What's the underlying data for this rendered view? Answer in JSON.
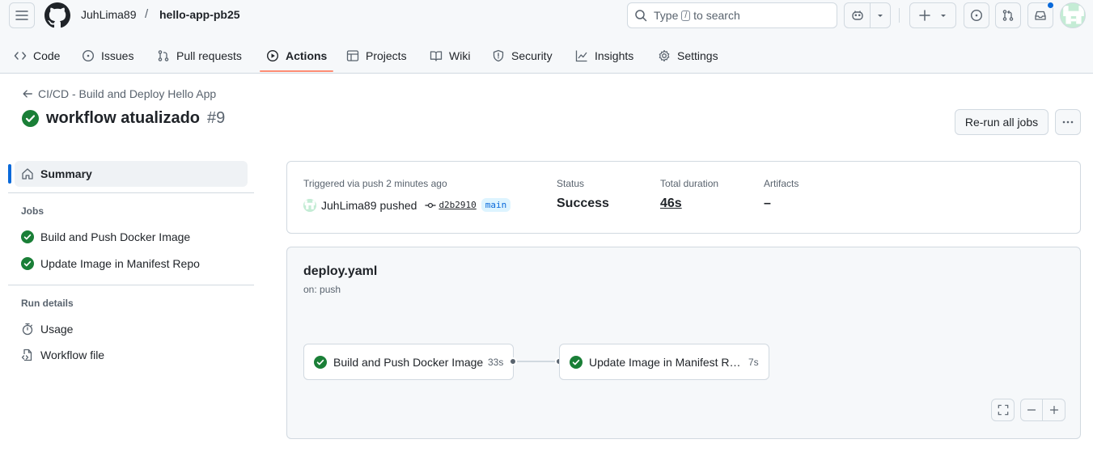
{
  "header": {
    "owner": "JuhLima89",
    "separator": "/",
    "repo": "hello-app-pb25",
    "search_prefix": "Type",
    "search_key": "/",
    "search_suffix": "to search"
  },
  "nav": {
    "items": [
      {
        "label": "Code",
        "icon": "code-icon"
      },
      {
        "label": "Issues",
        "icon": "issue-icon"
      },
      {
        "label": "Pull requests",
        "icon": "pull-request-icon"
      },
      {
        "label": "Actions",
        "icon": "play-icon",
        "active": true
      },
      {
        "label": "Projects",
        "icon": "table-icon"
      },
      {
        "label": "Wiki",
        "icon": "book-icon"
      },
      {
        "label": "Security",
        "icon": "shield-icon"
      },
      {
        "label": "Insights",
        "icon": "graph-icon"
      },
      {
        "label": "Settings",
        "icon": "gear-icon"
      }
    ]
  },
  "run": {
    "workflow_link": "CI/CD - Build and Deploy Hello App",
    "title": "workflow atualizado",
    "number": "#9",
    "rerun_label": "Re-run all jobs"
  },
  "sidebar": {
    "summary_label": "Summary",
    "jobs_heading": "Jobs",
    "jobs": [
      "Build and Push Docker Image",
      "Update Image in Manifest Repo"
    ],
    "run_details_heading": "Run details",
    "details": [
      "Usage",
      "Workflow file"
    ]
  },
  "summary": {
    "trigger_label": "Triggered via push 2 minutes ago",
    "actor": "JuhLima89",
    "action": "pushed",
    "commit": "d2b2910",
    "branch": "main",
    "status_label": "Status",
    "status_value": "Success",
    "duration_label": "Total duration",
    "duration_value": "46s",
    "artifacts_label": "Artifacts",
    "artifacts_value": "–"
  },
  "graph": {
    "workflow_file": "deploy.yaml",
    "trigger": "on: push",
    "jobs": [
      {
        "name": "Build and Push Docker Image",
        "duration": "33s"
      },
      {
        "name": "Update Image in Manifest R…",
        "duration": "7s"
      }
    ]
  },
  "colors": {
    "accent": "#0969da",
    "success": "#1a7f37",
    "active_tab_underline": "#fd8c73",
    "border": "#d1d9e0"
  }
}
